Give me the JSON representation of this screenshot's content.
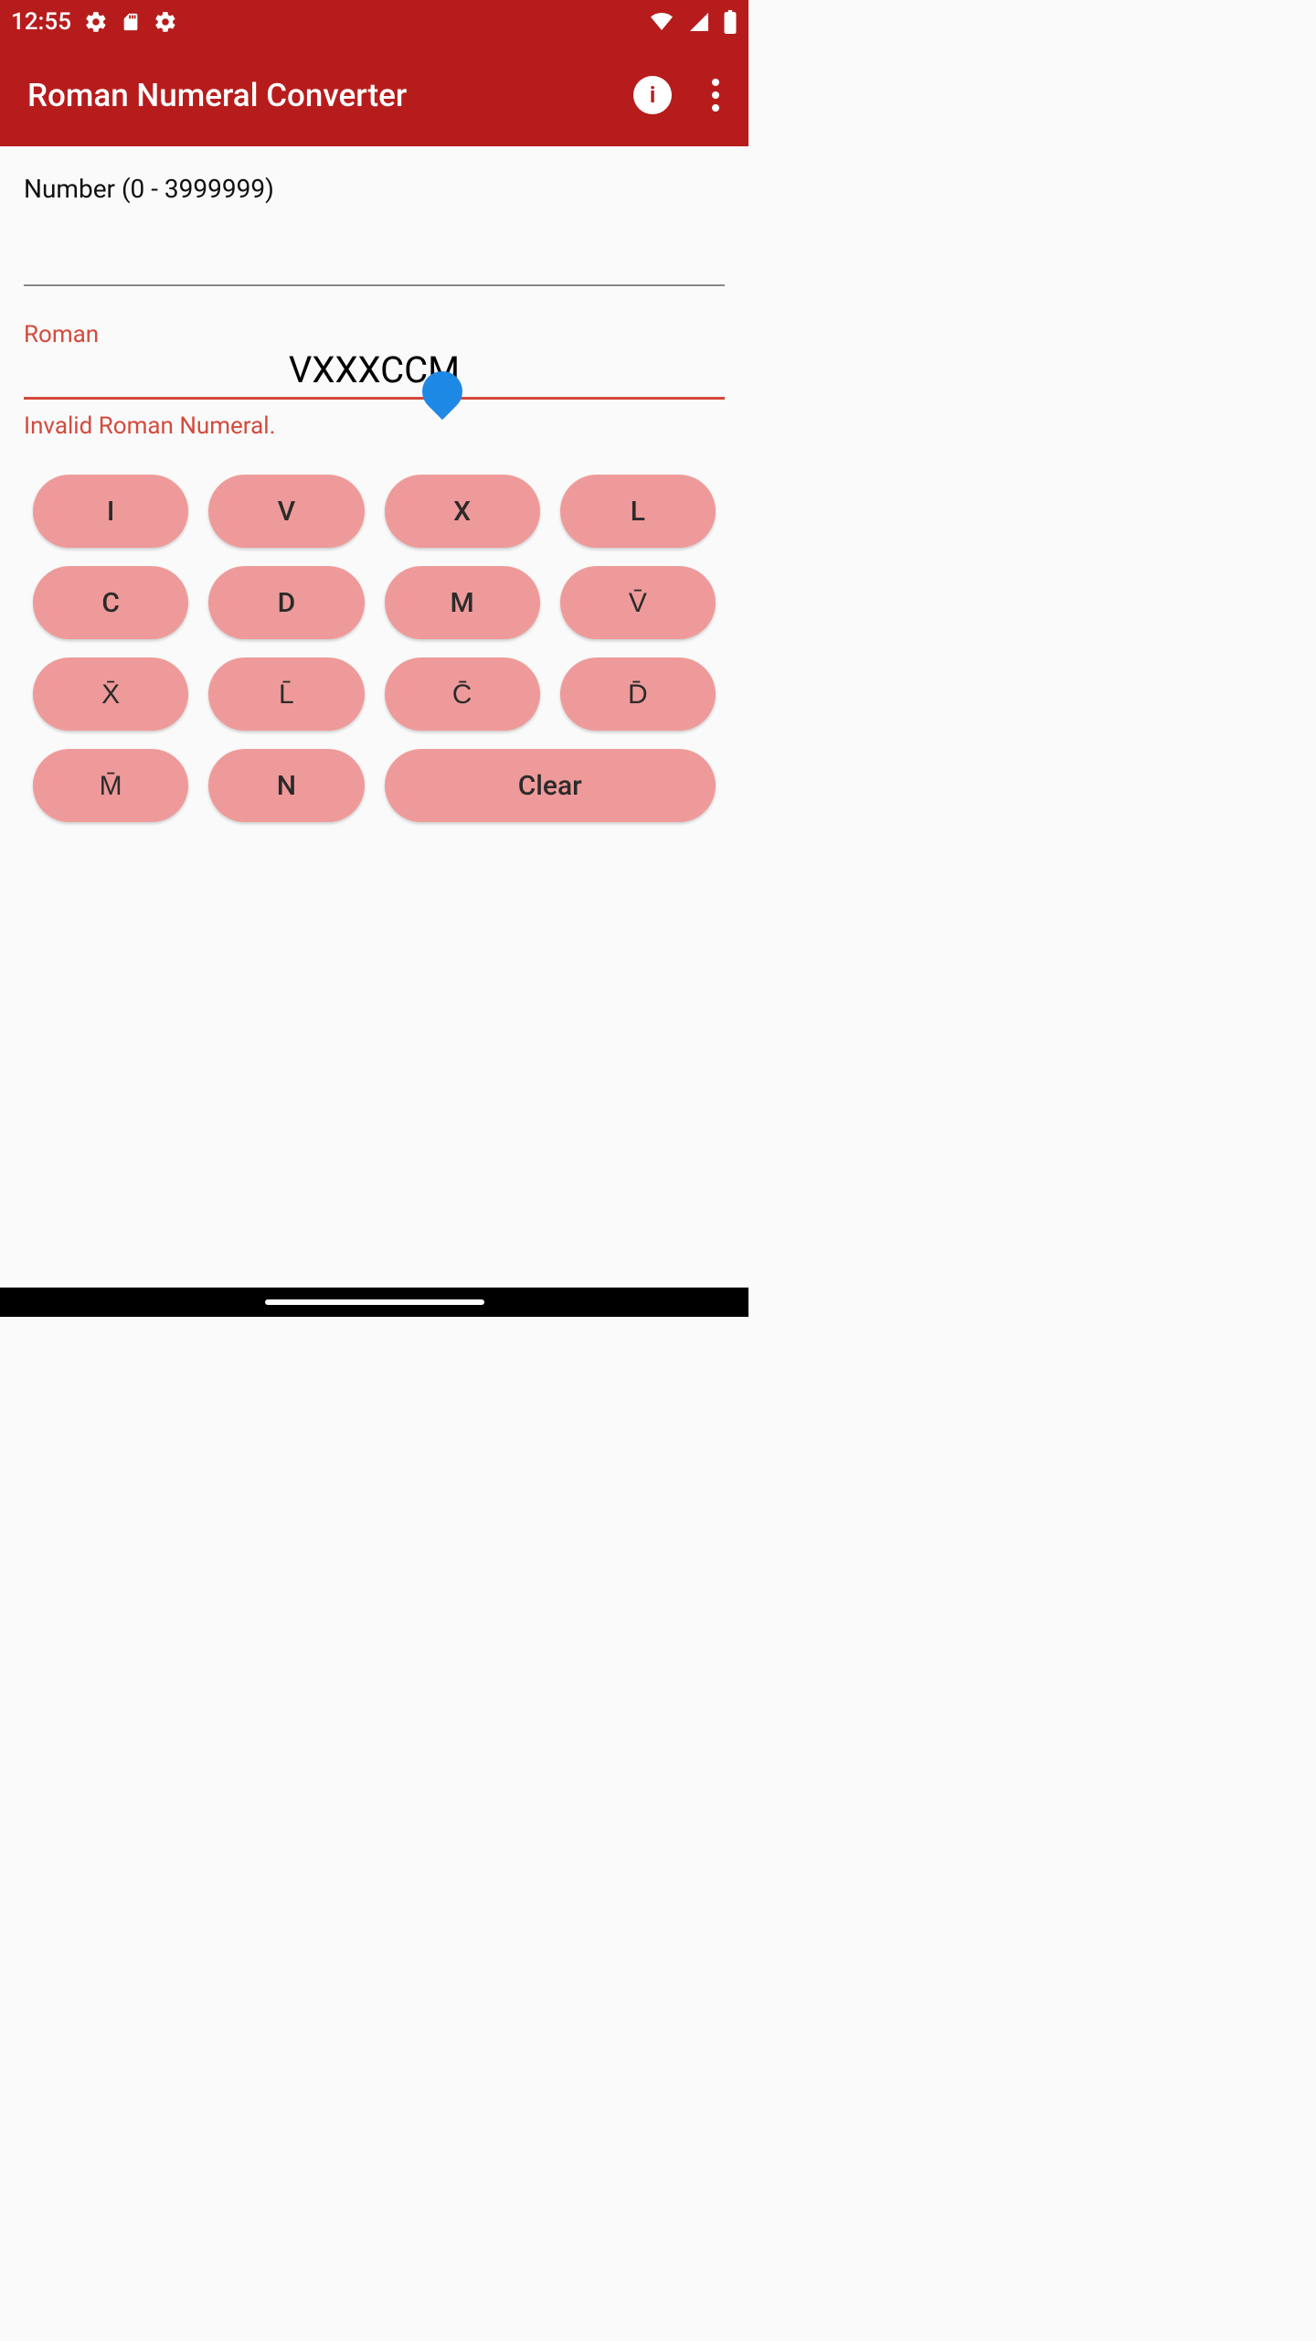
{
  "status": {
    "time": "12:55",
    "icons_left": [
      "gear-bug-icon",
      "sd-card-icon",
      "gear-bug-icon"
    ],
    "icons_right": [
      "wifi-icon",
      "signal-icon",
      "battery-icon"
    ]
  },
  "header": {
    "title": "Roman Numeral Converter"
  },
  "fields": {
    "number": {
      "label": "Number (0 - 3999999)",
      "value": ""
    },
    "roman": {
      "label": "Roman",
      "value": "VXXXCCM",
      "helper": "Invalid Roman Numeral."
    }
  },
  "keys": {
    "row1": [
      "I",
      "V",
      "X",
      "L"
    ],
    "row2": [
      "C",
      "D",
      "M",
      "V̄"
    ],
    "row3": [
      "X̄",
      "L̄",
      "C̄",
      "D̄"
    ],
    "row4": [
      "M̄",
      "N"
    ],
    "clear": "Clear"
  }
}
